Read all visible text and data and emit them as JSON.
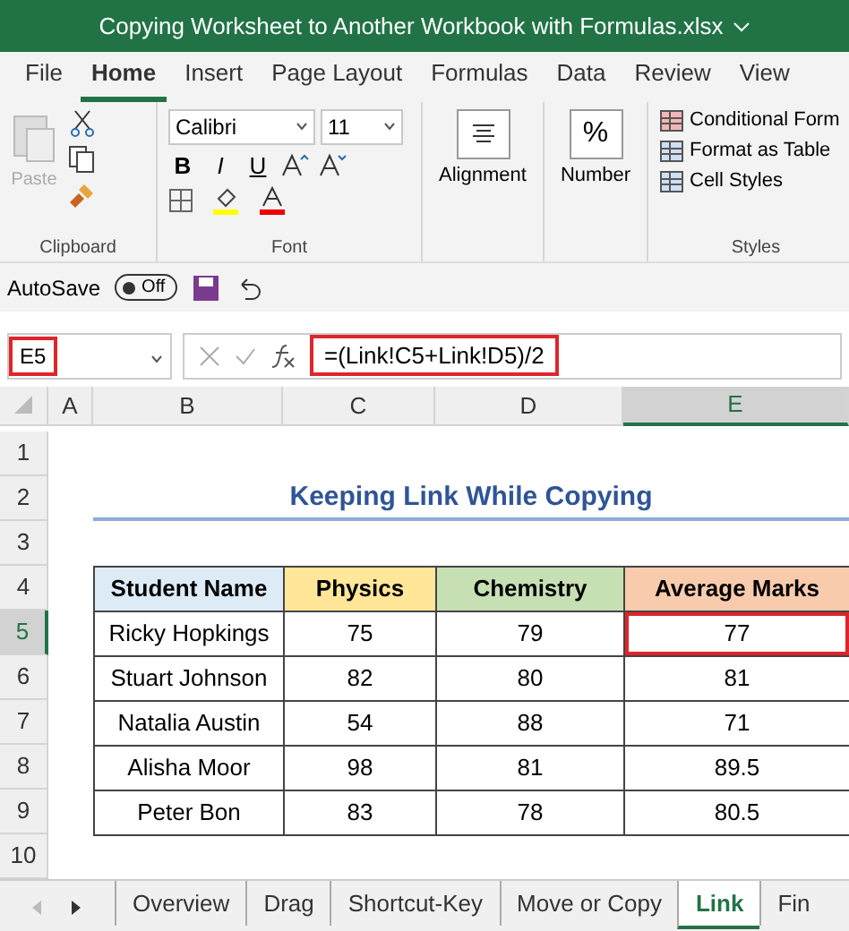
{
  "window": {
    "title": "Copying Worksheet to Another Workbook with Formulas.xlsx"
  },
  "ribbon_tabs": [
    {
      "label": "File",
      "selected": false
    },
    {
      "label": "Home",
      "selected": true
    },
    {
      "label": "Insert",
      "selected": false
    },
    {
      "label": "Page Layout",
      "selected": false
    },
    {
      "label": "Formulas",
      "selected": false
    },
    {
      "label": "Data",
      "selected": false
    },
    {
      "label": "Review",
      "selected": false
    },
    {
      "label": "View",
      "selected": false
    }
  ],
  "clipboard": {
    "paste": "Paste",
    "label": "Clipboard"
  },
  "font": {
    "name": "Calibri",
    "size": "11",
    "bold": "B",
    "italic": "I",
    "underline": "U",
    "label": "Font"
  },
  "alignment": {
    "label": "Alignment"
  },
  "number": {
    "symbol": "%",
    "label": "Number"
  },
  "styles": {
    "items": [
      "Conditional Form",
      "Format as Table",
      "Cell Styles"
    ],
    "label": "Styles"
  },
  "quick_access": {
    "autosave": "AutoSave",
    "toggle": "Off"
  },
  "formula_bar": {
    "name_box": "E5",
    "formula": "=(Link!C5+Link!D5)/2",
    "highlighted": true
  },
  "column_headers": [
    {
      "label": "A",
      "selected": false
    },
    {
      "label": "B",
      "selected": false
    },
    {
      "label": "C",
      "selected": false
    },
    {
      "label": "D",
      "selected": false
    },
    {
      "label": "E",
      "selected": true
    }
  ],
  "row_headers": [
    {
      "label": "1",
      "selected": false
    },
    {
      "label": "2",
      "selected": false
    },
    {
      "label": "3",
      "selected": false
    },
    {
      "label": "4",
      "selected": false
    },
    {
      "label": "5",
      "selected": true
    },
    {
      "label": "6",
      "selected": false
    },
    {
      "label": "7",
      "selected": false
    },
    {
      "label": "8",
      "selected": false
    },
    {
      "label": "9",
      "selected": false
    },
    {
      "label": "10",
      "selected": false
    }
  ],
  "sheet_title": "Keeping Link While Copying",
  "table": {
    "columns": [
      {
        "label": "Student Name",
        "color": "#ddebf7"
      },
      {
        "label": "Physics",
        "color": "#ffe699"
      },
      {
        "label": "Chemistry",
        "color": "#c6e0b4"
      },
      {
        "label": "Average Marks",
        "color": "#f8cbad"
      }
    ],
    "rows": [
      {
        "cells": [
          {
            "text": "Ricky Hopkings",
            "selected": false
          },
          {
            "text": "75",
            "selected": false
          },
          {
            "text": "79",
            "selected": false
          },
          {
            "text": "77",
            "selected": true
          }
        ]
      },
      {
        "cells": [
          {
            "text": "Stuart Johnson",
            "selected": false
          },
          {
            "text": "82",
            "selected": false
          },
          {
            "text": "80",
            "selected": false
          },
          {
            "text": "81",
            "selected": false
          }
        ]
      },
      {
        "cells": [
          {
            "text": "Natalia Austin",
            "selected": false
          },
          {
            "text": "54",
            "selected": false
          },
          {
            "text": "88",
            "selected": false
          },
          {
            "text": "71",
            "selected": false
          }
        ]
      },
      {
        "cells": [
          {
            "text": "Alisha Moor",
            "selected": false
          },
          {
            "text": "98",
            "selected": false
          },
          {
            "text": "81",
            "selected": false
          },
          {
            "text": "89.5",
            "selected": false
          }
        ]
      },
      {
        "cells": [
          {
            "text": "Peter Bon",
            "selected": false
          },
          {
            "text": "83",
            "selected": false
          },
          {
            "text": "78",
            "selected": false
          },
          {
            "text": "80.5",
            "selected": false
          }
        ]
      }
    ]
  },
  "sheet_tabs": [
    {
      "label": "Overview",
      "selected": false
    },
    {
      "label": "Drag",
      "selected": false
    },
    {
      "label": "Shortcut-Key",
      "selected": false
    },
    {
      "label": "Move or Copy",
      "selected": false
    },
    {
      "label": "Link",
      "selected": true
    },
    {
      "label": "Fin",
      "selected": false
    }
  ]
}
